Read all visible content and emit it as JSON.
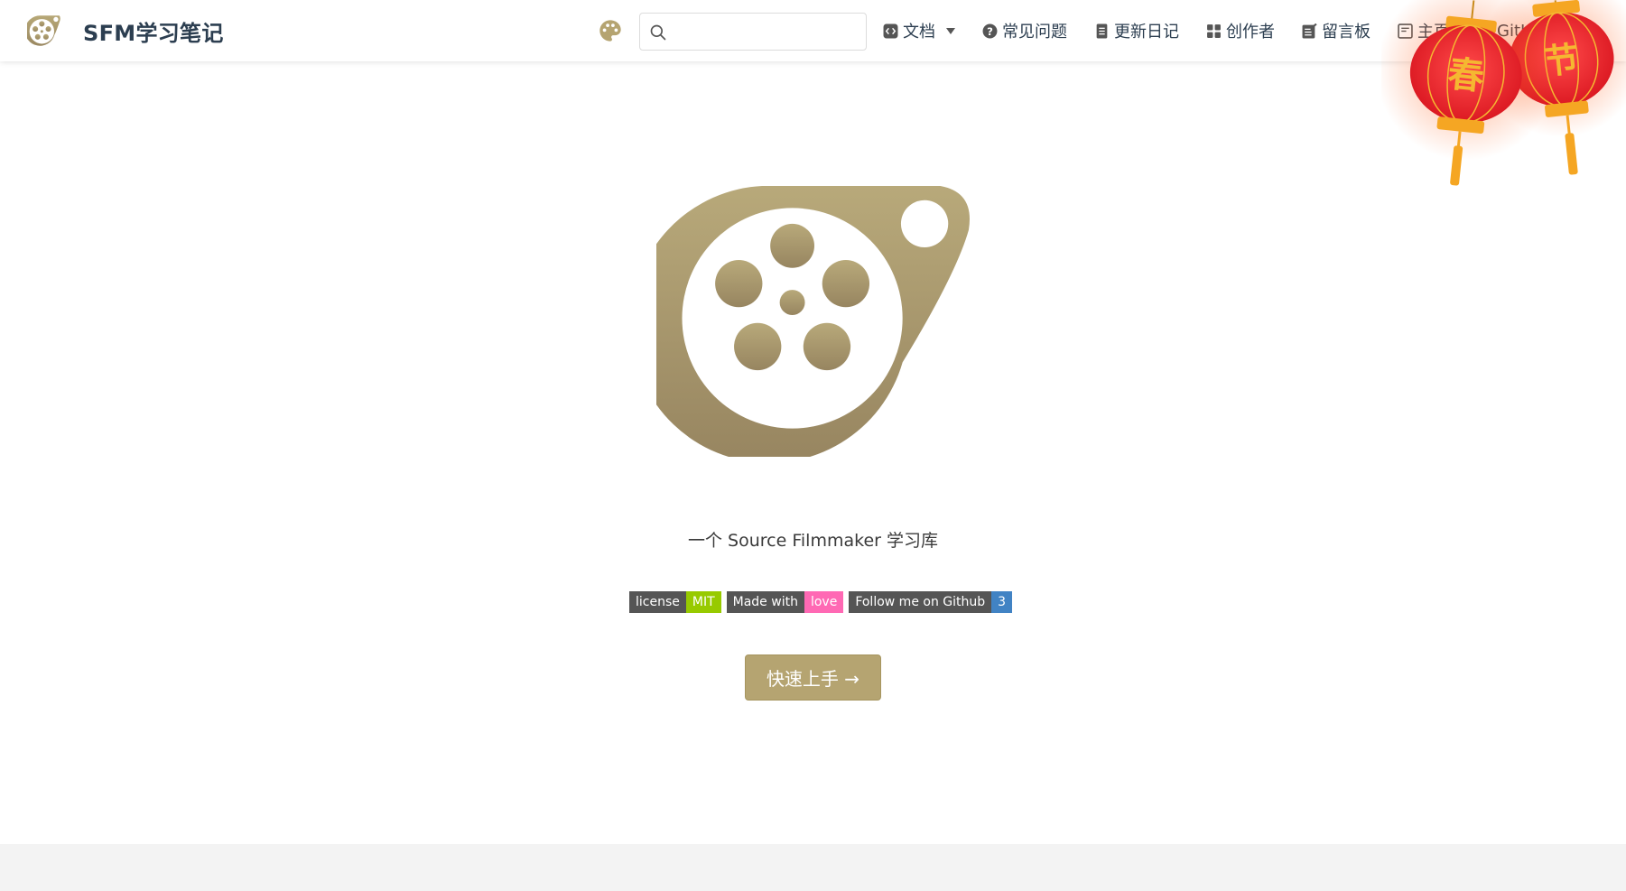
{
  "brand": {
    "title": "SFM学习笔记",
    "icon": "film-reel-icon"
  },
  "search": {
    "placeholder": "",
    "value": ""
  },
  "nav": {
    "items": [
      {
        "label": "文档",
        "icon": "code-doc-icon",
        "dropdown": true
      },
      {
        "label": "常见问题",
        "icon": "question-circle-icon"
      },
      {
        "label": "更新日记",
        "icon": "document-icon"
      },
      {
        "label": "创作者",
        "icon": "grid-icon"
      },
      {
        "label": "留言板",
        "icon": "note-edit-icon"
      },
      {
        "label": "主页",
        "icon": "page-icon"
      },
      {
        "label": "GitHub",
        "icon": "github-icon",
        "external": true
      }
    ]
  },
  "decoration": {
    "lantern_left_char": "春",
    "lantern_right_char": "节"
  },
  "hero": {
    "tagline": "一个 Source Filmmaker 学习库",
    "cta_label": "快速上手 →"
  },
  "badges": [
    {
      "left": "license",
      "right": "MIT",
      "color": "#97ca00"
    },
    {
      "left": "Made with",
      "right": "love",
      "color": "#ff69b4"
    },
    {
      "left": "Follow me on Github",
      "right": "3",
      "color": "#4183c4"
    }
  ],
  "colors": {
    "accent": "#b5a471",
    "accent_dark": "#9c8a5f",
    "text": "#2c3e50",
    "footer": "#f3f3f3",
    "lantern_red": "#e8232d",
    "lantern_gold": "#f5a623"
  }
}
